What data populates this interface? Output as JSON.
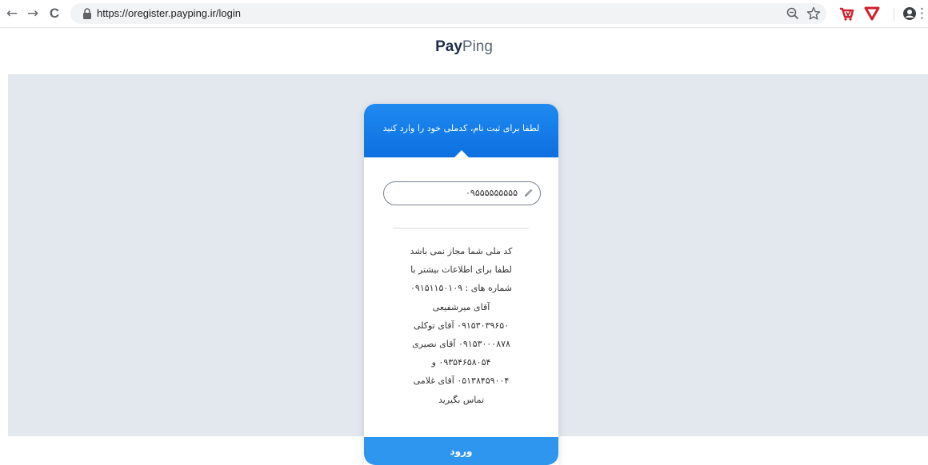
{
  "browser": {
    "url": "https://oregister.payping.ir/login",
    "icons": [
      "back-arrow-icon",
      "forward-arrow-icon",
      "reload-icon",
      "lock-icon",
      "zoom-icon",
      "star-icon",
      "extension-cart-icon",
      "extension-shield-icon",
      "profile-icon",
      "menu-dots-icon"
    ],
    "nav_back": "←",
    "nav_forward": "→",
    "nav_reload": "C",
    "menu_dots": "⋮"
  },
  "header": {
    "logo_bold": "Pay",
    "logo_light": "Ping"
  },
  "card": {
    "title": "لطفا برای ثبت نام، کدملی خود را وارد کنید",
    "national_code_value": "۰۹۵۵۵۵۵۵۵۵۵",
    "message_lines": [
      "کد ملی شما مجاز نمی باشد",
      "لطفا برای اطلاعات بیشتر با",
      "شماره های : ۰۹۱۵۱۱۵۰۱۰۹",
      "آقای میرشفیعی",
      "۰۹۱۵۳۰۳۹۶۵۰ آقای توکلی",
      "۰۹۱۵۳۰۰۰۸۷۸ آقای نصیری",
      "۰۹۳۵۴۶۵۸۰۵۴ و",
      "۰۵۱۳۸۴۵۹۰۰۴ آقای غلامی",
      "تماس بگیرید"
    ],
    "login_button": "ورود"
  },
  "colors": {
    "header_blue": "#0d6fe0",
    "button_blue": "#2f96f0",
    "band_gray": "#e3e7ee",
    "ext_red": "#d11f2b"
  }
}
